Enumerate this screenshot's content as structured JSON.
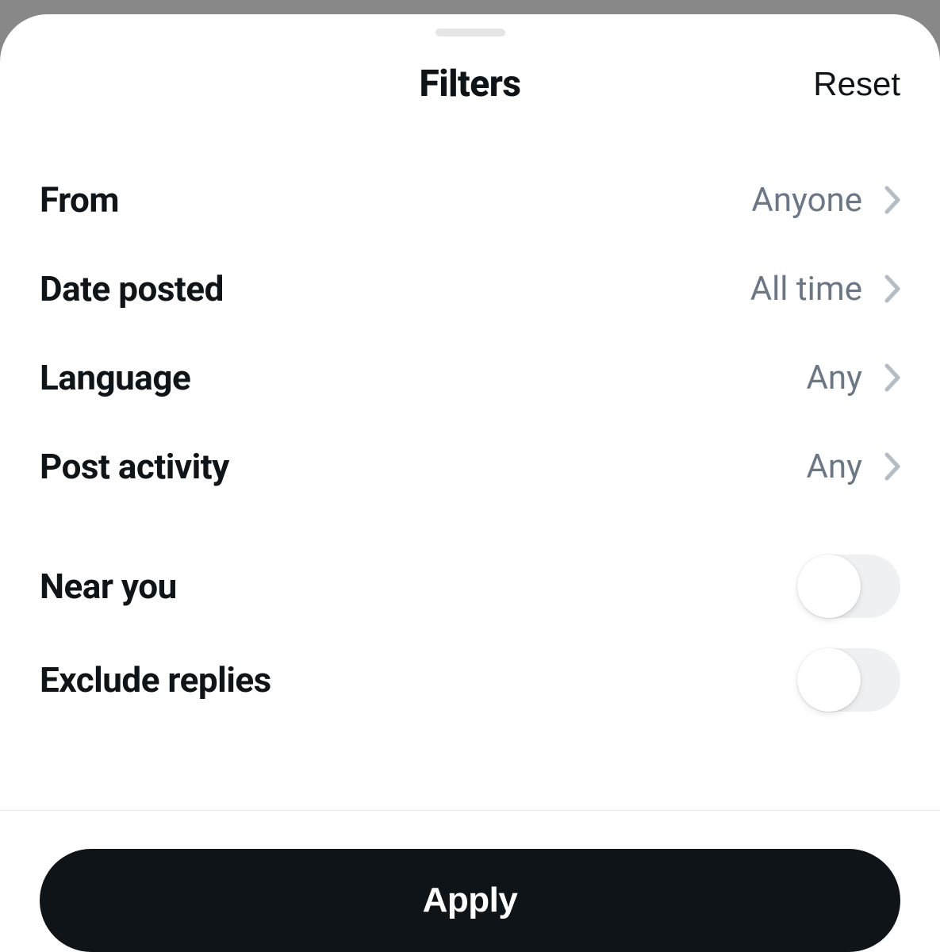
{
  "header": {
    "title": "Filters",
    "reset_label": "Reset"
  },
  "filters": {
    "from": {
      "label": "From",
      "value": "Anyone"
    },
    "date_posted": {
      "label": "Date posted",
      "value": "All time"
    },
    "language": {
      "label": "Language",
      "value": "Any"
    },
    "post_activity": {
      "label": "Post activity",
      "value": "Any"
    }
  },
  "toggles": {
    "near_you": {
      "label": "Near you",
      "on": false
    },
    "exclude_replies": {
      "label": "Exclude replies",
      "on": false
    }
  },
  "footer": {
    "apply_label": "Apply"
  }
}
